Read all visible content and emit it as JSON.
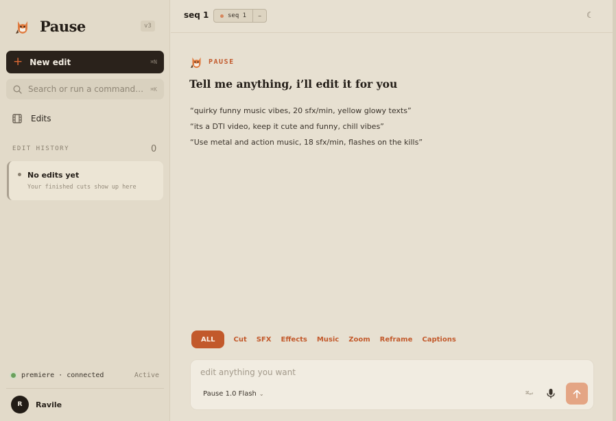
{
  "sidebar": {
    "brand_name": "Pause",
    "version": "v3",
    "new_edit": {
      "label": "New edit",
      "shortcut": "⌘N"
    },
    "search": {
      "placeholder": "Search or run a command…",
      "shortcut": "⌘K"
    },
    "nav_edits_label": "Edits",
    "history": {
      "title": "EDIT HISTORY",
      "count": "0",
      "empty_title": "No edits yet",
      "empty_subtitle": "Your finished cuts show up here"
    },
    "status": {
      "text": "premiere · connected",
      "state": "Active"
    },
    "user": {
      "initial": "R",
      "name": "Ravile"
    }
  },
  "topbar": {
    "sequence_title": "seq 1",
    "tab_label": "seq 1",
    "tab_close": "–"
  },
  "main": {
    "brand_label": "PAUSE",
    "headline": "Tell me anything, i’ll edit it for you",
    "examples": [
      "“quirky funny music vibes, 20 sfx/min, yellow glowy texts”",
      "“its a DTI video, keep it cute and funny, chill vibes”",
      "“Use metal and action music, 18 sfx/min, flashes on the kills”"
    ],
    "filters": [
      "ALL",
      "Cut",
      "SFX",
      "Effects",
      "Music",
      "Zoom",
      "Reframe",
      "Captions"
    ],
    "composer": {
      "placeholder": "edit anything you want",
      "model": "Pause 1.0 Flash",
      "shortcut": "⌘↵"
    }
  },
  "colors": {
    "accent": "#c2592b",
    "sidebar_bg": "#e2dac9",
    "main_bg": "#e7e0d1",
    "dark_button": "#2a221b",
    "connected": "#6aa15c"
  },
  "icons": [
    "cat-logo-icon",
    "plus-icon",
    "search-icon",
    "film-icon",
    "moon-icon",
    "mic-icon",
    "send-arrow-icon",
    "chevron-down-icon"
  ]
}
